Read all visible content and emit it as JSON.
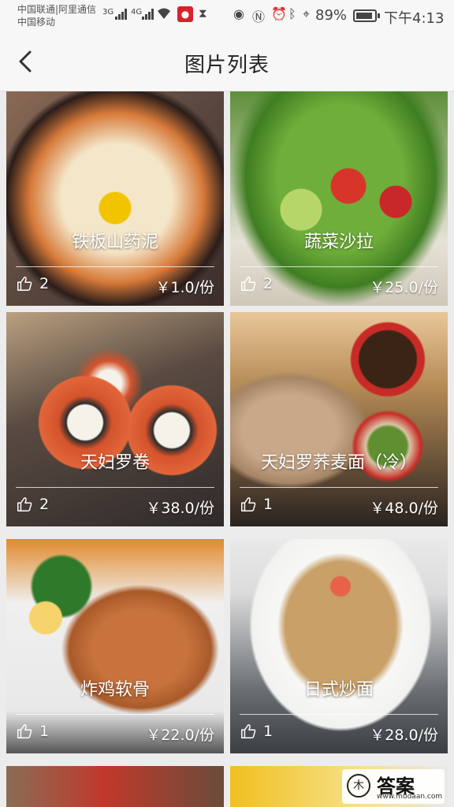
{
  "status_bar": {
    "carrier_1": "中国联通|阿里通信",
    "carrier_2": "中国移动",
    "net_1": "3G",
    "net_2": "4G",
    "battery": "89%",
    "time": "下午4:13"
  },
  "header": {
    "title": "图片列表"
  },
  "dishes": [
    {
      "name": "铁板山药泥",
      "likes": "2",
      "price": "￥1.0/份"
    },
    {
      "name": "蔬菜沙拉",
      "likes": "2",
      "price": "￥25.0/份"
    },
    {
      "name": "天妇罗卷",
      "likes": "2",
      "price": "￥38.0/份"
    },
    {
      "name": "天妇罗荞麦面（冷）",
      "likes": "1",
      "price": "￥48.0/份"
    },
    {
      "name": "炸鸡软骨",
      "likes": "1",
      "price": "￥22.0/份"
    },
    {
      "name": "日式炒面",
      "likes": "1",
      "price": "￥28.0/份"
    }
  ],
  "watermark": {
    "text": "答案",
    "url": "www.mudaan.com"
  },
  "icons": {
    "back": "chevron-left-icon",
    "like": "thumbs-up-icon",
    "wifi": "wifi-icon",
    "mic": "microphone-icon",
    "eye": "eye-icon",
    "nfc": "nfc-icon",
    "bluetooth": "bluetooth-icon",
    "location": "location-icon"
  },
  "battery_level": 0.89
}
